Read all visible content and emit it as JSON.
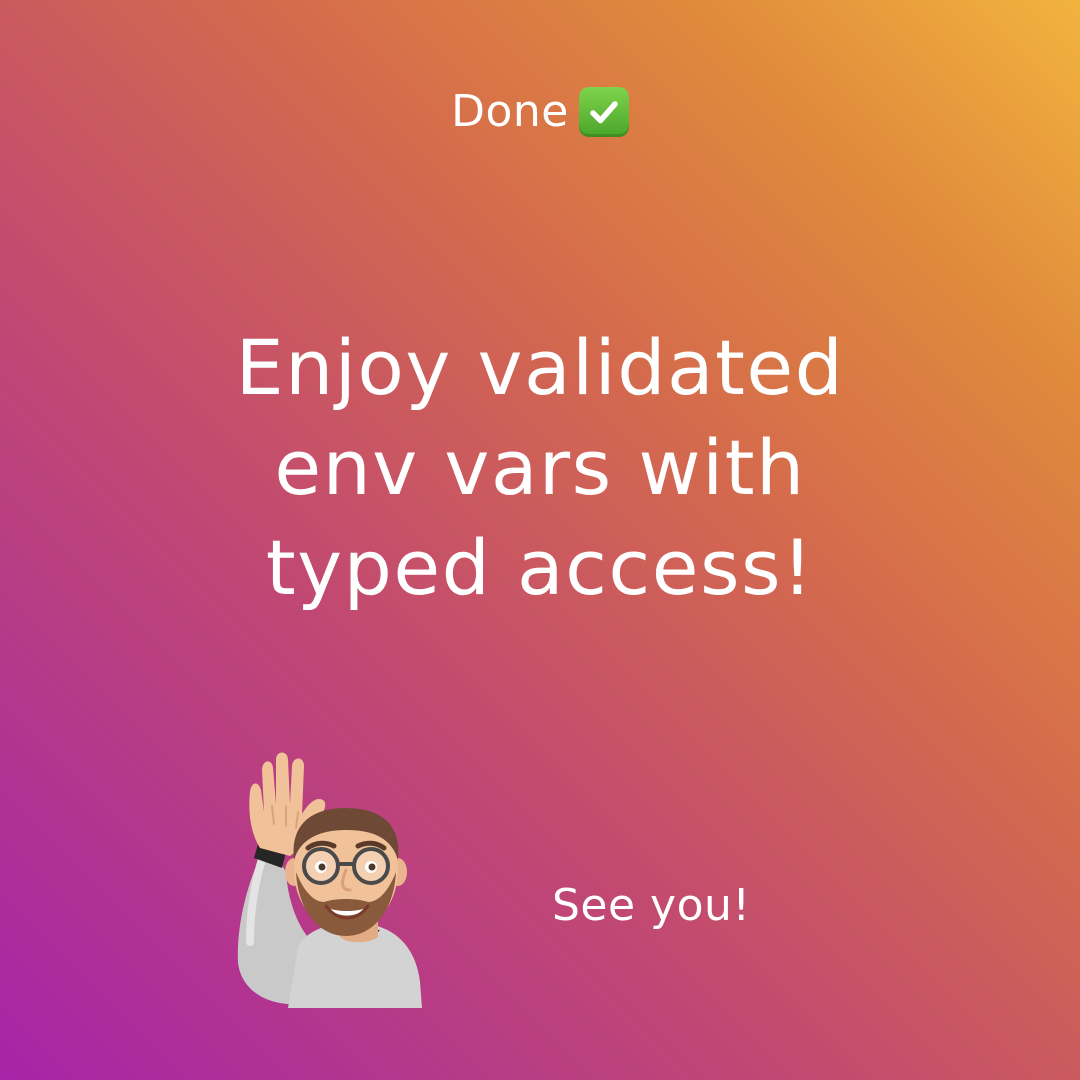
{
  "status": {
    "label": "Done",
    "icon": "check-mark-button-icon",
    "icon_color": "#5cbf34"
  },
  "headline": {
    "lines": [
      "Enjoy validated",
      "env vars with",
      "typed access!"
    ]
  },
  "farewell": {
    "text": "See you!",
    "avatar": "waving-memoji-avatar"
  },
  "colors": {
    "gradient_bottom_left": "#a724a8",
    "gradient_top_right": "#f2b33e",
    "text": "#ffffff"
  }
}
